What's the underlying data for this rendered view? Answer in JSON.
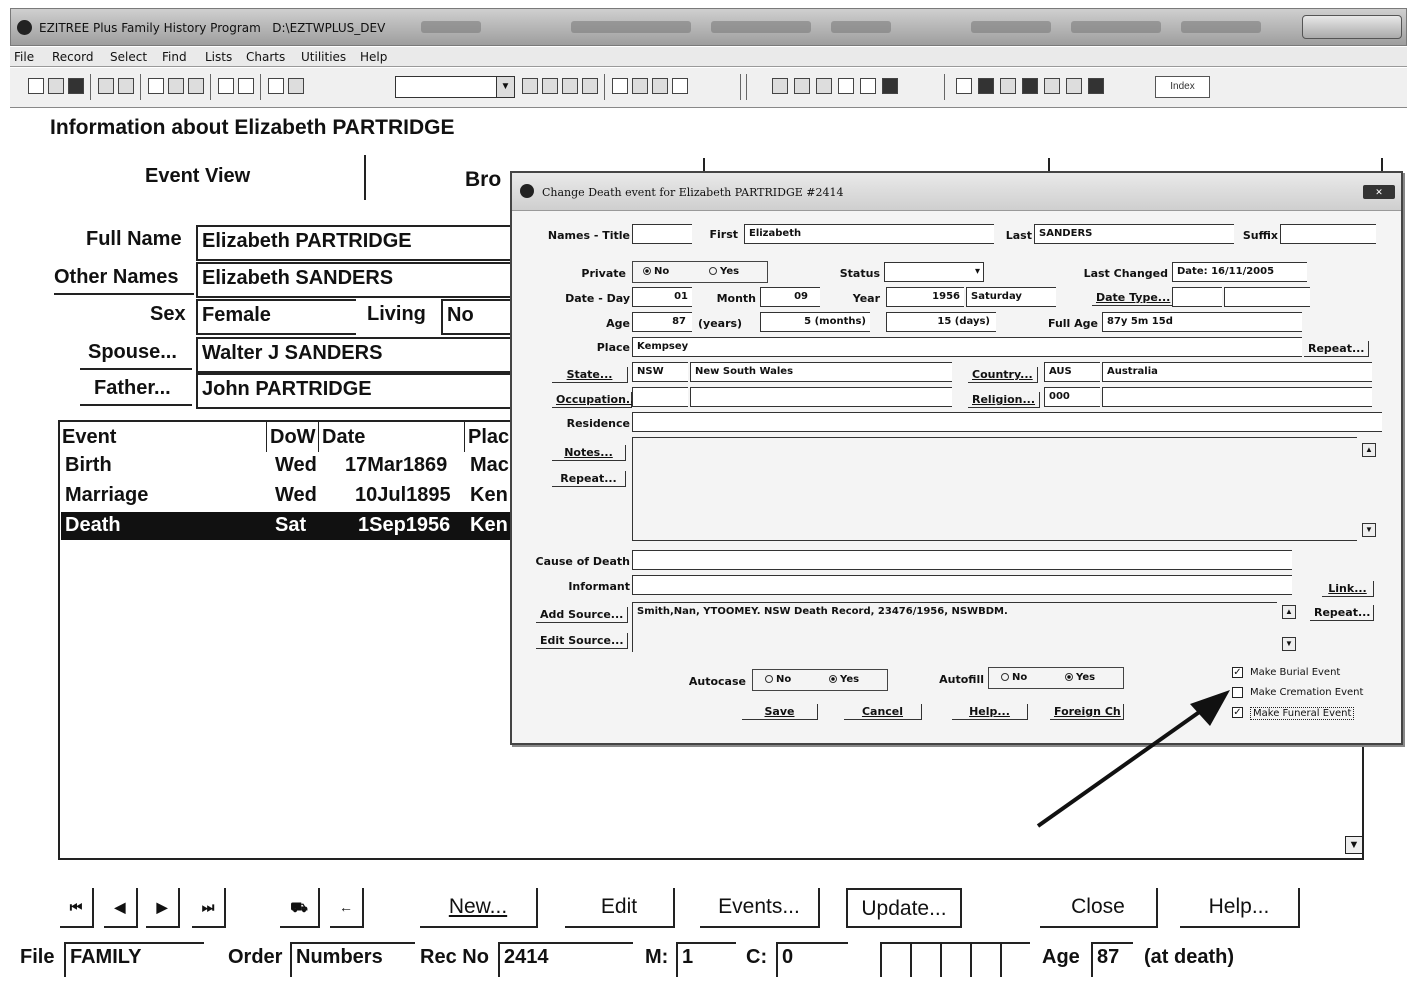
{
  "app": {
    "title": "EZITREE Plus Family History Program",
    "database": "D:\\EZTWPLUS_DEV"
  },
  "menu": [
    "File",
    "Record",
    "Select",
    "Find",
    "Lists",
    "Charts",
    "Utilities",
    "Help"
  ],
  "toolbar": {
    "index_label": "Index"
  },
  "main": {
    "header": "Information about Elizabeth PARTRIDGE",
    "tabs": [
      "Event View",
      "Bro"
    ],
    "fields": {
      "full_name_label": "Full Name",
      "full_name": "Elizabeth PARTRIDGE",
      "other_names_label": "Other Names",
      "other_names": "Elizabeth SANDERS",
      "sex_label": "Sex",
      "sex": "Female",
      "living_label": "Living",
      "living": "No",
      "spouse_label": "Spouse...",
      "spouse": "Walter J SANDERS",
      "father_label": "Father...",
      "father": "John PARTRIDGE"
    },
    "event_list": {
      "columns": [
        "Event",
        "DoW",
        "Date",
        "Plac"
      ],
      "rows": [
        {
          "event": "Birth",
          "dow": "Wed",
          "date": "17Mar1869",
          "place": "Mac"
        },
        {
          "event": "Marriage",
          "dow": "Wed",
          "date": "10Jul1895",
          "place": "Ken"
        },
        {
          "event": "Death",
          "dow": "Sat",
          "date": "1Sep1956",
          "place": "Ken"
        }
      ]
    },
    "buttons": {
      "new": "New...",
      "edit": "Edit",
      "events": "Events...",
      "update": "Update...",
      "close": "Close",
      "help": "Help..."
    },
    "nav": [
      "⏮",
      "◀",
      "▶",
      "⏭"
    ],
    "status": {
      "file_label": "File",
      "file": "FAMILY",
      "order_label": "Order",
      "order": "Numbers",
      "recno_label": "Rec No",
      "recno": "2414",
      "m_label": "M:",
      "m": "1",
      "c_label": "C:",
      "c": "0",
      "age_label": "Age",
      "age": "87",
      "age_note": "(at death)"
    }
  },
  "dialog": {
    "title": "Change Death event for Elizabeth PARTRIDGE  #2414",
    "names_title_label": "Names - Title",
    "first_label": "First",
    "first": "Elizabeth",
    "last_label": "Last",
    "last": "SANDERS",
    "suffix_label": "Suffix",
    "private_label": "Private",
    "private_no": "No",
    "private_yes": "Yes",
    "status_label": "Status",
    "last_changed_label": "Last Changed",
    "last_changed": "Date: 16/11/2005",
    "date_day_label": "Date - Day",
    "day": "01",
    "month_label": "Month",
    "month": "09",
    "year_label": "Year",
    "year": "1956",
    "weekday": "Saturday",
    "date_type_label": "Date Type...",
    "age_label": "Age",
    "age_years": "87",
    "years_label": "(years)",
    "age_months": "5",
    "months_label": "(months)",
    "age_days": "15",
    "days_label": "(days)",
    "full_age_label": "Full Age",
    "full_age": "87y 5m 15d",
    "place_label": "Place",
    "place": "Kempsey",
    "repeat_place": "Repeat...",
    "state_label": "State...",
    "state_code": "NSW",
    "state_name": "New South Wales",
    "country_label": "Country...",
    "country_code": "AUS",
    "country_name": "Australia",
    "occupation_label": "Occupation...",
    "religion_label": "Religion...",
    "religion_code": "000",
    "residence_label": "Residence",
    "notes_label": "Notes...",
    "repeat_notes": "Repeat...",
    "cause_label": "Cause of Death",
    "informant_label": "Informant",
    "link_label": "Link...",
    "add_source_label": "Add Source...",
    "source_text": "Smith,Nan, YTOOMEY. NSW Death Record, 23476/1956, NSWBDM.",
    "repeat_source": "Repeat...",
    "edit_source_label": "Edit Source...",
    "autocase_label": "Autocase",
    "autocase_no": "No",
    "autocase_yes": "Yes",
    "autofill_label": "Autofill",
    "autofill_no": "No",
    "autofill_yes": "Yes",
    "save": "Save",
    "cancel": "Cancel",
    "help": "Help...",
    "foreign": "Foreign Ch",
    "chk_burial": "Make Burial Event",
    "chk_cremation": "Make Cremation Event",
    "chk_funeral": "Make Funeral Event",
    "chk_burial_checked": true,
    "chk_cremation_checked": false,
    "chk_funeral_checked": true
  }
}
